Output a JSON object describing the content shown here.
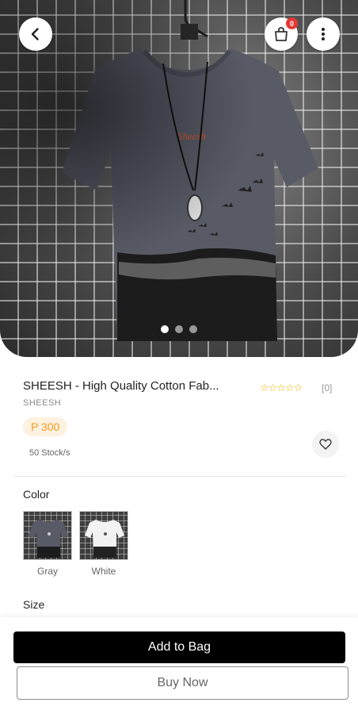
{
  "header": {
    "back_icon": "arrow-left-icon",
    "bag_icon": "shopping-bag-icon",
    "bag_count": "0",
    "more_icon": "more-vertical-icon"
  },
  "gallery": {
    "image_count": 3,
    "active_index": 0
  },
  "product": {
    "title": "SHEESH - High Quality Cotton Fab...",
    "brand": "SHEESH",
    "rating_stars": "☆☆☆☆☆",
    "rating": 0,
    "review_count": "[0]",
    "price": "P 300",
    "stock": "50 Stock/s",
    "wishlist_icon": "heart-outline-icon"
  },
  "options": {
    "color_label": "Color",
    "colors": [
      {
        "name": "Gray"
      },
      {
        "name": "White"
      }
    ],
    "size_label": "Size"
  },
  "actions": {
    "add_to_bag": "Add to Bag",
    "buy_now": "Buy Now"
  },
  "colors": {
    "price_text": "#f59a1c",
    "price_bg": "#fdf1e0",
    "badge": "#e53935",
    "star": "#f4b400",
    "primary_button": "#000000"
  }
}
